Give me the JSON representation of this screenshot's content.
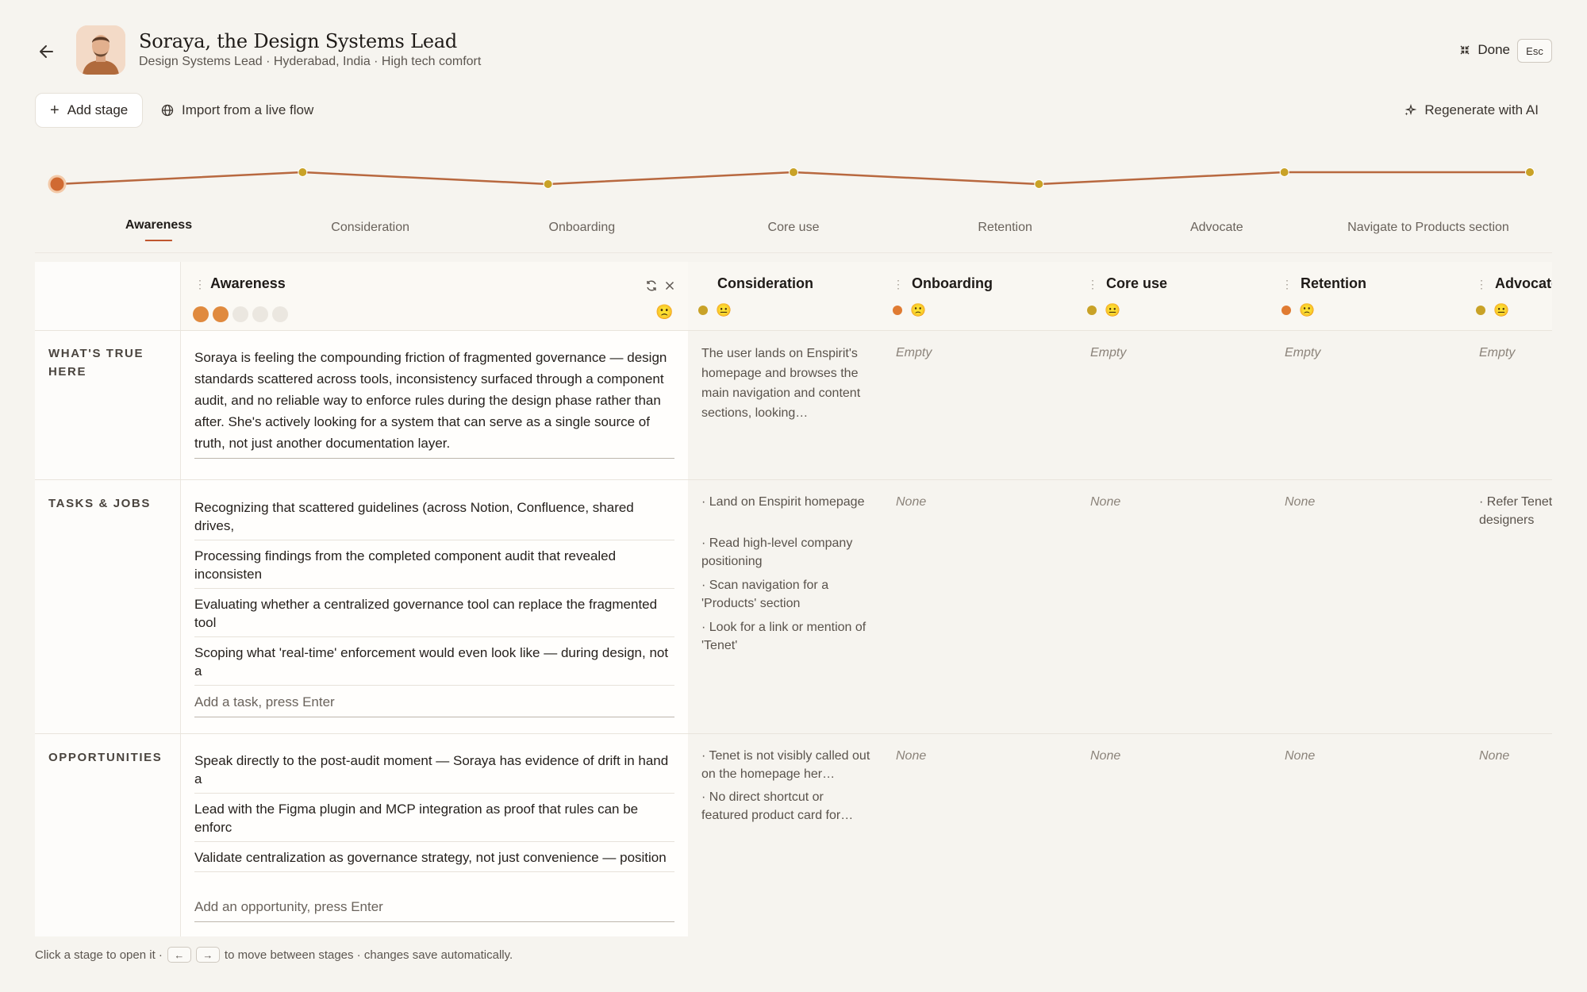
{
  "header": {
    "title": "Soraya, the Design Systems Lead",
    "subtitle": "Design Systems Lead · Hyderabad, India · High tech comfort",
    "done_label": "Done",
    "esc_label": "Esc"
  },
  "toolbar": {
    "add_stage_label": "Add stage",
    "import_label": "Import from a live flow",
    "regenerate_label": "Regenerate with AI"
  },
  "timeline": {
    "stages": [
      "Awareness",
      "Consideration",
      "Onboarding",
      "Core use",
      "Retention",
      "Advocate",
      "Navigate to Products section"
    ],
    "active_index": 0,
    "line_color": "#b8683f",
    "active_color": "#d06a32",
    "dot_color": "#c9a227"
  },
  "matrix": {
    "row_labels": [
      "WHAT'S TRUE HERE",
      "TASKS & JOBS",
      "OPPORTUNITIES"
    ],
    "columns": [
      {
        "title": "Awareness",
        "rating": 2,
        "rating_max": 5,
        "emoji": "🙁",
        "whats_true": "Soraya is feeling the compounding friction of fragmented governance — design standards scattered across tools, inconsistency surfaced through a component audit, and no reliable way to enforce rules during the design phase rather than after. She's actively looking for a system that can serve as a single source of truth, not just another documentation layer.",
        "tasks": [
          "Recognizing that scattered guidelines (across Notion, Confluence, shared drives,",
          "Processing findings from the completed component audit that revealed inconsisten",
          "Evaluating whether a centralized governance tool can replace the fragmented tool",
          "Scoping what 'real-time' enforcement would even look like — during design, not a"
        ],
        "task_placeholder": "Add a task, press Enter",
        "opportunities": [
          "Speak directly to the post-audit moment — Soraya has evidence of drift in hand a",
          "Lead with the Figma plugin and MCP integration as proof that rules can be enforc",
          "Validate centralization as governance strategy, not just convenience — position"
        ],
        "opportunity_placeholder": "Add an opportunity, press Enter"
      },
      {
        "title": "Consideration",
        "emoji": "😐",
        "whats_true": "The user lands on Enspirit's homepage and browses the main navigation and content sections, looking…",
        "tasks": [
          "· Land on Enspirit homepage",
          "· Read high-level company positioning",
          "· Scan navigation for a 'Products' section",
          "· Look for a link or mention of 'Tenet'"
        ],
        "opportunities": [
          "· Tenet is not visibly called out on the homepage her…",
          "· No direct shortcut or featured product card for…"
        ]
      },
      {
        "title": "Onboarding",
        "emoji": "🙁",
        "whats_true": "Empty",
        "tasks": "None",
        "opportunities": "None"
      },
      {
        "title": "Core use",
        "emoji": "😐",
        "whats_true": "Empty",
        "tasks": "None",
        "opportunities": "None"
      },
      {
        "title": "Retention",
        "emoji": "🙁",
        "whats_true": "Empty",
        "tasks": "None",
        "opportunities": "None"
      },
      {
        "title": "Advocate",
        "emoji": "😐",
        "whats_true": "Empty",
        "tasks": [
          "· Refer Tenet designers"
        ],
        "opportunities": "None"
      }
    ]
  },
  "footer": {
    "text_before": "Click a stage to open it ·",
    "left_key": "←",
    "right_key": "→",
    "text_after": "to move between stages · changes save automatically."
  },
  "colors": {
    "background": "#f6f4ef",
    "accent": "#d06a32",
    "rating_filled": "#e08a3e",
    "rating_empty": "#ebe7e0",
    "dot_orange": "#e07b32",
    "dot_yellow": "#c9a227"
  }
}
